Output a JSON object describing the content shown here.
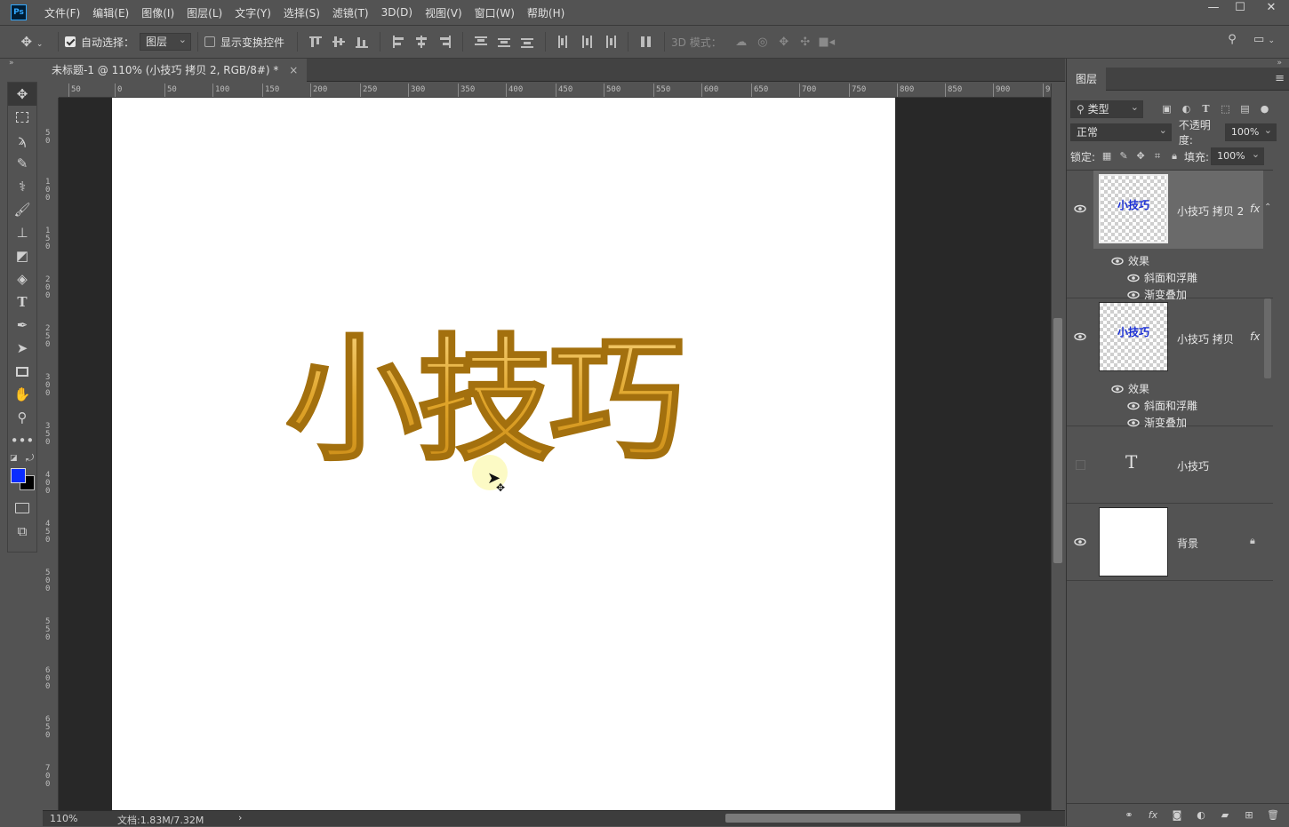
{
  "app": {
    "logo": "Ps"
  },
  "menu": [
    "文件(F)",
    "编辑(E)",
    "图像(I)",
    "图层(L)",
    "文字(Y)",
    "选择(S)",
    "滤镜(T)",
    "3D(D)",
    "视图(V)",
    "窗口(W)",
    "帮助(H)"
  ],
  "window_controls": {
    "minimize": "—",
    "maximize": "☐",
    "close": "✕"
  },
  "options": {
    "auto_select_label": "自动选择：",
    "auto_select_target": "图层",
    "show_transform_label": "显示变换控件",
    "mode3d_label": "3D 模式："
  },
  "document": {
    "tab_title": "未标题-1 @ 110% (小技巧 拷贝 2, RGB/8#) *",
    "close": "×",
    "art_text": "小技巧"
  },
  "ruler_h": [
    "50",
    "0",
    "50",
    "100",
    "150",
    "200",
    "250",
    "300",
    "350",
    "400",
    "450",
    "500",
    "550",
    "600",
    "650",
    "700",
    "750",
    "800",
    "850",
    "900",
    "9"
  ],
  "ruler_v": [
    "5\n0",
    "1\n0\n0",
    "1\n5\n0",
    "2\n0\n0",
    "2\n5\n0",
    "3\n0\n0",
    "3\n5\n0",
    "4\n0\n0",
    "4\n5\n0",
    "5\n0\n0",
    "5\n5\n0",
    "6\n0\n0",
    "6\n5\n0",
    "7\n0\n0"
  ],
  "status": {
    "zoom": "110%",
    "doc": "文档:1.83M/7.32M",
    "arrow": "›"
  },
  "layers_panel": {
    "tab": "图层",
    "filter_kind": "类型",
    "blend_mode": "正常",
    "opacity_label": "不透明度:",
    "opacity_value": "100%",
    "lock_label": "锁定:",
    "fill_label": "填充:",
    "fill_value": "100%",
    "layers": [
      {
        "name": "小技巧 拷贝 2",
        "thumb_text": "小技巧",
        "fx": "fx",
        "effects_label": "效果",
        "effects": [
          "斜面和浮雕",
          "渐变叠加"
        ],
        "visible": true,
        "selected": true
      },
      {
        "name": "小技巧 拷贝",
        "thumb_text": "小技巧",
        "fx": "fx",
        "effects_label": "效果",
        "effects": [
          "斜面和浮雕",
          "渐变叠加"
        ],
        "visible": true,
        "selected": false
      },
      {
        "name": "小技巧",
        "type_glyph": "T",
        "visible": false,
        "selected": false
      },
      {
        "name": "背景",
        "visible": true,
        "selected": false,
        "locked": true
      }
    ]
  },
  "colors": {
    "foreground": "#0a2cff",
    "background": "#000000",
    "accent": "#31a8ff",
    "gold": "#e0a52a"
  }
}
